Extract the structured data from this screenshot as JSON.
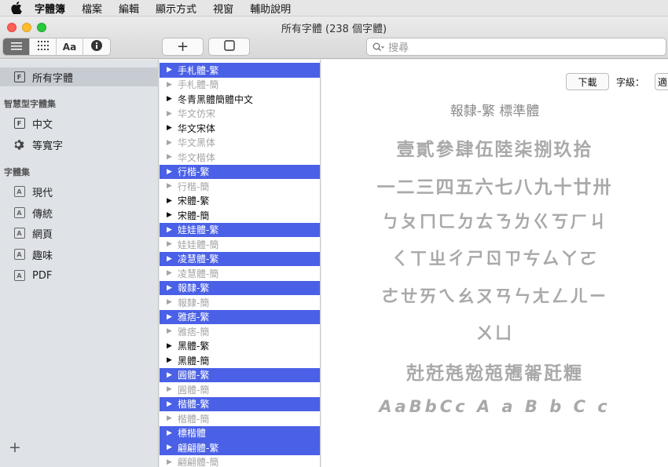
{
  "menubar": {
    "items": [
      "字體簿",
      "檔案",
      "編輯",
      "顯示方式",
      "視窗",
      "輔助說明"
    ]
  },
  "window": {
    "title": "所有字體 (238 個字體)"
  },
  "toolbar": {
    "view_segments": [
      "list-icon",
      "grid-icon",
      "Aa",
      "info-icon"
    ],
    "add_label": "+",
    "search_placeholder": "搜尋"
  },
  "sidebar": {
    "all_fonts": "所有字體",
    "smart_heading": "智慧型字體集",
    "smart_items": [
      "中文",
      "等寬字"
    ],
    "collections_heading": "字體集",
    "collections": [
      "現代",
      "傳統",
      "網頁",
      "趣味",
      "PDF"
    ],
    "add_label": "+"
  },
  "font_list": [
    {
      "label": "手札體-繁",
      "state": "selected"
    },
    {
      "label": "手札體-簡",
      "state": "dim"
    },
    {
      "label": "冬青黑體簡體中文",
      "state": "normal"
    },
    {
      "label": "华文仿宋",
      "state": "dim"
    },
    {
      "label": "华文宋体",
      "state": "normal"
    },
    {
      "label": "华文黑体",
      "state": "dim"
    },
    {
      "label": "华文楷体",
      "state": "dim"
    },
    {
      "label": "行楷-繁",
      "state": "selected"
    },
    {
      "label": "行楷-簡",
      "state": "dim"
    },
    {
      "label": "宋體-繁",
      "state": "normal"
    },
    {
      "label": "宋體-簡",
      "state": "normal"
    },
    {
      "label": "娃娃體-繁",
      "state": "selected"
    },
    {
      "label": "娃娃體-簡",
      "state": "dim"
    },
    {
      "label": "凌慧體-繁",
      "state": "selected"
    },
    {
      "label": "凌慧體-簡",
      "state": "dim"
    },
    {
      "label": "報隸-繁",
      "state": "selected"
    },
    {
      "label": "報隸-簡",
      "state": "dim"
    },
    {
      "label": "雅痞-繁",
      "state": "selected"
    },
    {
      "label": "雅痞-簡",
      "state": "dim"
    },
    {
      "label": "黑體-繁",
      "state": "normal"
    },
    {
      "label": "黑體-簡",
      "state": "normal"
    },
    {
      "label": "圓體-繁",
      "state": "selected"
    },
    {
      "label": "圓體-簡",
      "state": "dim"
    },
    {
      "label": "楷體-繁",
      "state": "selected"
    },
    {
      "label": "楷體-簡",
      "state": "dim"
    },
    {
      "label": "標楷體",
      "state": "selected"
    },
    {
      "label": "翩翩體-繁",
      "state": "selected"
    },
    {
      "label": "翩翩體-簡",
      "state": "dim"
    }
  ],
  "preview": {
    "download_label": "下載",
    "size_label": "字級：",
    "size_value": "適",
    "title": "報隸-繁 標準體",
    "lines": [
      "壹貳參肆伍陸柒捌玖拾",
      "一二三四五六七八九十廿卅",
      "ㄅㄆㄇㄈㄉㄊㄋㄌㄍㄎㄏㄐ",
      "ㄑㄒㄓㄔㄕㄖㄗㄘㄙㄚㄛ",
      "ㄜㄝㄞㄟㄠㄡㄢㄣㄤㄥㄦㄧ",
      "ㄨㄩ",
      "兙兛兞兝兡兣嗧瓩糎"
    ],
    "latin": "AaBbCc  A  a  B  b  C  c"
  },
  "colors": {
    "selection": "#4a60e6",
    "sidebar_bg": "#dfe3e8",
    "preview_text": "#a9a9a9"
  }
}
